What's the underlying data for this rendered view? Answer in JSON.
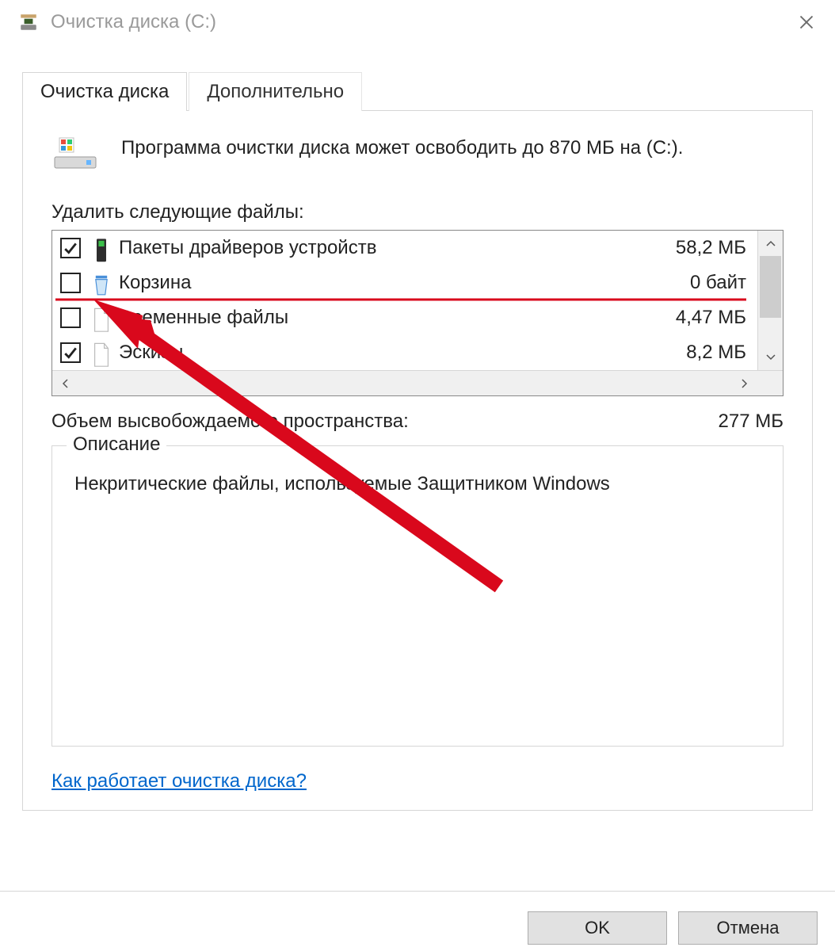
{
  "window": {
    "title": "Очистка диска  (C:)"
  },
  "tabs": {
    "active": "Очистка диска",
    "other": "Дополнительно"
  },
  "summary": "Программа очистки диска может освободить до 870 МБ на  (С:).",
  "files_label": "Удалить следующие файлы:",
  "files": [
    {
      "checked": true,
      "icon": "device",
      "label": "Пакеты драйверов устройств",
      "size": "58,2 МБ"
    },
    {
      "checked": false,
      "icon": "bin",
      "label": "Корзина",
      "size": "0 байт"
    },
    {
      "checked": false,
      "icon": "file",
      "label": "Временные файлы",
      "size": "4,47 МБ"
    },
    {
      "checked": true,
      "icon": "file",
      "label": "Эскизы",
      "size": "8,2 МБ"
    }
  ],
  "totals": {
    "label": "Объем высвобождаемого пространства:",
    "value": "277 МБ"
  },
  "description": {
    "legend": "Описание",
    "text": "Некритические файлы, используемые Защитником Windows"
  },
  "help_link": "Как работает очистка диска?",
  "buttons": {
    "ok": "OK",
    "cancel": "Отмена"
  }
}
